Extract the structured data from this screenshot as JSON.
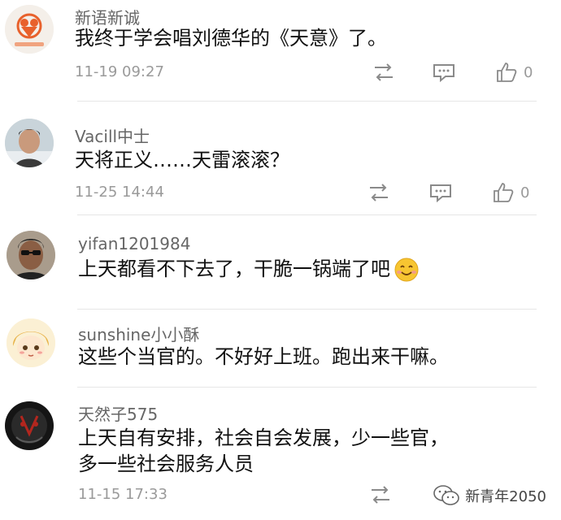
{
  "comments": [
    {
      "username": "新语新诚",
      "text": "我终于学会唱刘德华的《天意》了。",
      "timestamp": "11-19 09:27",
      "likes": "0",
      "avatar_icon": "heart-logo-avatar"
    },
    {
      "username": "Vacill中士",
      "text": "天将正义……天雷滚滚？",
      "timestamp": "11-25 14:44",
      "likes": "0",
      "avatar_icon": "man-photo-avatar"
    },
    {
      "username": "yifan1201984",
      "text": "上天都看不下去了，干脆一锅端了吧",
      "avatar_icon": "sunglasses-man-avatar"
    },
    {
      "username": "sunshine小小酥",
      "text": "这些个当官的。不好好上班。跑出来干嘛。",
      "avatar_icon": "cartoon-girl-avatar"
    },
    {
      "username": "天然子575",
      "text_line1": "上天自有安排，社会自会发展，少一些官，",
      "text_line2": "多一些社会服务人员",
      "timestamp": "11-15 17:33",
      "avatar_icon": "dark-mask-avatar"
    }
  ],
  "watermark": {
    "text": "新青年2050",
    "icon": "wechat-icon"
  },
  "colors": {
    "meta_gray": "#9a9a9a",
    "username_gray": "#666666",
    "divider": "#e6e6e6",
    "accent_orange": "#e8612c"
  }
}
